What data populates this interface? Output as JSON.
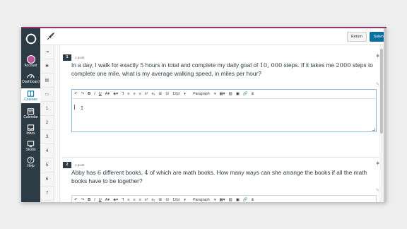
{
  "nav": {
    "items": [
      {
        "label": "Account",
        "icon": "avatar"
      },
      {
        "label": "Dashboard",
        "icon": "dashboard-icon"
      },
      {
        "label": "Courses",
        "icon": "courses-icon"
      },
      {
        "label": "Calendar",
        "icon": "calendar-icon"
      },
      {
        "label": "Inbox",
        "icon": "inbox-icon"
      },
      {
        "label": "Studio",
        "icon": "studio-icon"
      },
      {
        "label": "Help",
        "icon": "help-icon"
      }
    ]
  },
  "topbar": {
    "return_label": "Return",
    "submit_label": "Submit"
  },
  "question_index": [
    "1",
    "2",
    "3",
    "4",
    "5",
    "6",
    "7",
    "8"
  ],
  "questions": [
    {
      "number": "1",
      "points": "1 point",
      "text_parts": [
        "In a day, I walk for exactly ",
        "5",
        " hours in total and complete my daily goal of ",
        "10, 000",
        " steps. If it takes me ",
        "2000",
        " steps to complete one mile, what is my average walking speed, in miles per hour?"
      ]
    },
    {
      "number": "2",
      "points": "1 point",
      "text_parts": [
        "Abby has ",
        "6",
        " different books, ",
        "4",
        " of which are math books. How many ways can she arrange the books if all the math books have to be together?"
      ]
    }
  ],
  "editor": {
    "font_size": "12pt",
    "paragraph": "Paragraph"
  },
  "colors": {
    "nav_bg": "#2d3b45",
    "submit_bg": "#0770a3",
    "accent_top": "#8b3a6b"
  }
}
